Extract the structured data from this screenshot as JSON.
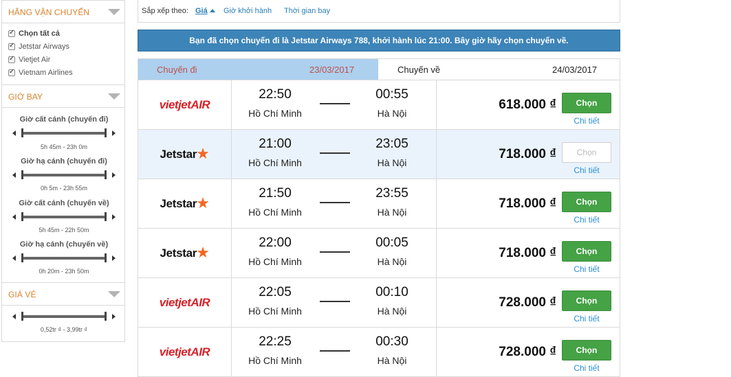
{
  "sidebar": {
    "airlines_title": "Hãng vận chuyển",
    "airlines": [
      {
        "label": "Chọn tất cả",
        "checked": true,
        "bold": true
      },
      {
        "label": "Jetstar Airways",
        "checked": true,
        "bold": false
      },
      {
        "label": "Vietjet Air",
        "checked": true,
        "bold": false
      },
      {
        "label": "Vietnam Airlines",
        "checked": true,
        "bold": false
      }
    ],
    "time_title": "Giờ bay",
    "sliders": [
      {
        "label": "Giờ cất cánh (chuyến đi)",
        "range": "5h 45m - 23h 0m"
      },
      {
        "label": "Giờ hạ cánh (chuyến đi)",
        "range": "0h 5m - 23h 55m"
      },
      {
        "label": "Giờ cất cánh (chuyến về)",
        "range": "5h 45m - 22h 50m"
      },
      {
        "label": "Giờ hạ cánh (chuyến về)",
        "range": "0h 20m - 23h 50m"
      }
    ],
    "price_title": "Giá vé",
    "price_range": "0,52tr ₫ - 3,99tr ₫"
  },
  "sort": {
    "label": "Sắp xếp theo:",
    "options": [
      "Giá",
      "Giờ khởi hành",
      "Thời gian bay"
    ],
    "active": "Giá"
  },
  "notice": "Bạn đã chọn chuyến đi là Jetstar Airways 788, khởi hành lúc 21:00. Bây giờ hãy chọn chuyến về.",
  "tabs": {
    "outbound_label": "Chuyến đi",
    "outbound_date": "23/03/2017",
    "return_label": "Chuyến về",
    "return_date": "24/03/2017"
  },
  "flights": [
    {
      "airline": "vietjet",
      "logo_text": "vietjetAIR",
      "dep_time": "22:50",
      "arr_time": "00:55",
      "from": "Hồ Chí Minh",
      "to": "Hà Nội",
      "price": "618.000 ₫",
      "select": "Chọn",
      "detail": "Chi tiết",
      "selected": false
    },
    {
      "airline": "jetstar",
      "logo_text": "Jetstar",
      "dep_time": "21:00",
      "arr_time": "23:05",
      "from": "Hồ Chí Minh",
      "to": "Hà Nội",
      "price": "718.000 ₫",
      "select": "Chọn",
      "detail": "Chi tiết",
      "selected": true
    },
    {
      "airline": "jetstar",
      "logo_text": "Jetstar",
      "dep_time": "21:50",
      "arr_time": "23:55",
      "from": "Hồ Chí Minh",
      "to": "Hà Nội",
      "price": "718.000 ₫",
      "select": "Chọn",
      "detail": "Chi tiết",
      "selected": false
    },
    {
      "airline": "jetstar",
      "logo_text": "Jetstar",
      "dep_time": "22:00",
      "arr_time": "00:05",
      "from": "Hồ Chí Minh",
      "to": "Hà Nội",
      "price": "718.000 ₫",
      "select": "Chọn",
      "detail": "Chi tiết",
      "selected": false
    },
    {
      "airline": "vietjet",
      "logo_text": "vietjetAIR",
      "dep_time": "22:05",
      "arr_time": "00:10",
      "from": "Hồ Chí Minh",
      "to": "Hà Nội",
      "price": "728.000 ₫",
      "select": "Chọn",
      "detail": "Chi tiết",
      "selected": false
    },
    {
      "airline": "vietjet",
      "logo_text": "vietjetAIR",
      "dep_time": "22:25",
      "arr_time": "00:30",
      "from": "Hồ Chí Minh",
      "to": "Hà Nội",
      "price": "728.000 ₫",
      "select": "Chọn",
      "detail": "Chi tiết",
      "selected": false
    }
  ],
  "colors": {
    "accent": "#d9822b",
    "banner": "#3d84b8",
    "tab_active": "#acd0ee",
    "button": "#45a245",
    "link": "#2a8fd0",
    "vietjet": "#d6232a",
    "jetstar_star": "#f26722"
  }
}
